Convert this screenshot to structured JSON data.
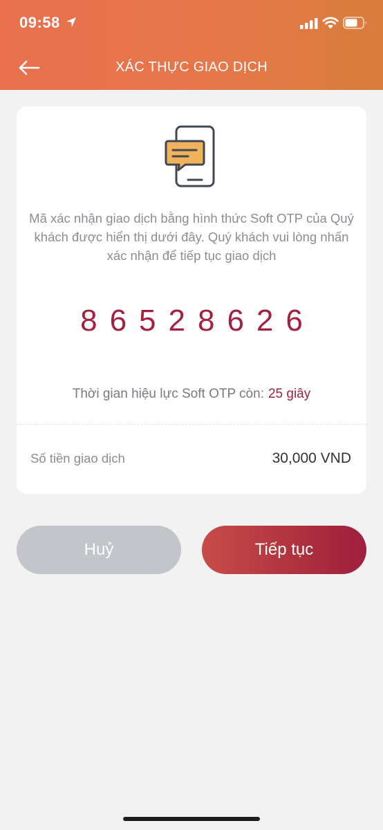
{
  "status_bar": {
    "time": "09:58",
    "icons": [
      "location-arrow-icon",
      "cellular-signal-icon",
      "wifi-icon",
      "battery-icon"
    ]
  },
  "header": {
    "title": "XÁC THỰC GIAO DỊCH",
    "back_icon": "back-arrow-icon",
    "background_colors": [
      "#e8704f",
      "#d87d3c"
    ]
  },
  "card": {
    "illustration_icon": "phone-message-icon",
    "message": "Mã xác nhận giao dịch bằng hình thức Soft OTP của Quý khách được hiển thị dưới đây. Quý khách vui lòng nhấn xác nhận để tiếp tục giao dịch",
    "otp_code": "86528626",
    "validity_label": "Thời gian hiệu lực Soft OTP còn:",
    "validity_countdown": "25 giây",
    "amount_label": "Số tiền giao dịch",
    "amount_value": "30,000 VND"
  },
  "buttons": {
    "cancel_label": "Huỷ",
    "continue_label": "Tiếp tục"
  },
  "colors": {
    "accent": "#a3203f",
    "cancel_button": "#c2c5ca",
    "background": "#f2f2f3"
  }
}
